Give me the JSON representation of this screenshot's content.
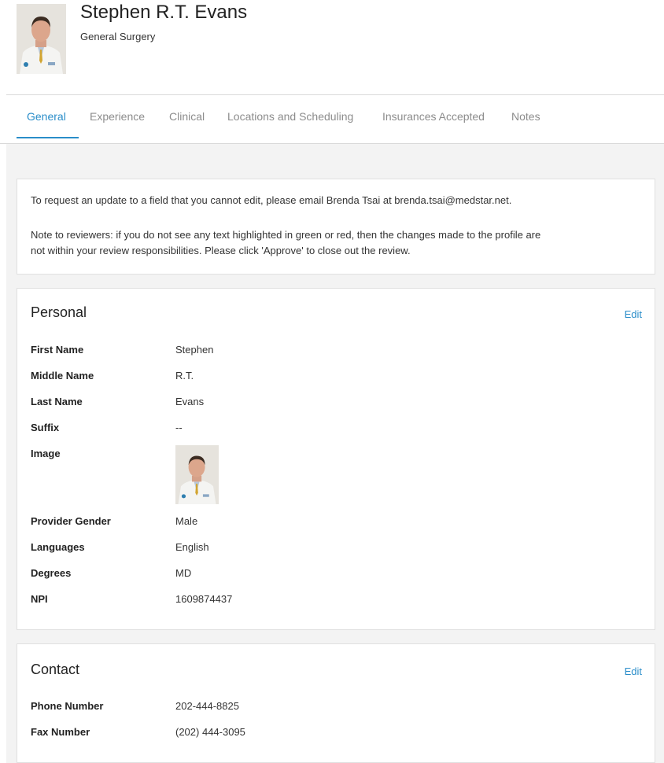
{
  "profile": {
    "name": "Stephen R.T. Evans",
    "specialty": "General Surgery"
  },
  "tabs": [
    {
      "label": "General",
      "active": true
    },
    {
      "label": "Experience",
      "active": false
    },
    {
      "label": "Clinical",
      "active": false
    },
    {
      "label": "Locations and Scheduling",
      "active": false
    },
    {
      "label": "Insurances Accepted",
      "active": false
    },
    {
      "label": "Notes",
      "active": false
    }
  ],
  "notice": {
    "line1": "To request an update to a field that you cannot edit, please email Brenda Tsai at brenda.tsai@medstar.net.",
    "line2": "Note to reviewers: if you do not see any text highlighted in green or red, then the changes made to the profile are",
    "line3": "not within your review responsibilities. Please click 'Approve' to close out the review."
  },
  "personal": {
    "title": "Personal",
    "edit_label": "Edit",
    "fields": {
      "first_name": {
        "label": "First Name",
        "value": "Stephen"
      },
      "middle_name": {
        "label": "Middle Name",
        "value": "R.T."
      },
      "last_name": {
        "label": "Last Name",
        "value": "Evans"
      },
      "suffix": {
        "label": "Suffix",
        "value": "--"
      },
      "image": {
        "label": "Image"
      },
      "gender": {
        "label": "Provider Gender",
        "value": "Male"
      },
      "languages": {
        "label": "Languages",
        "value": "English"
      },
      "degrees": {
        "label": "Degrees",
        "value": "MD"
      },
      "npi": {
        "label": "NPI",
        "value": "1609874437"
      }
    }
  },
  "contact": {
    "title": "Contact",
    "edit_label": "Edit",
    "fields": {
      "phone": {
        "label": "Phone Number",
        "value": "202-444-8825"
      },
      "fax": {
        "label": "Fax Number",
        "value": "(202) 444-3095"
      }
    }
  },
  "colors": {
    "accent": "#2a8dc9",
    "page_bg": "#f3f3f3",
    "card_border": "#e0e0e0"
  }
}
